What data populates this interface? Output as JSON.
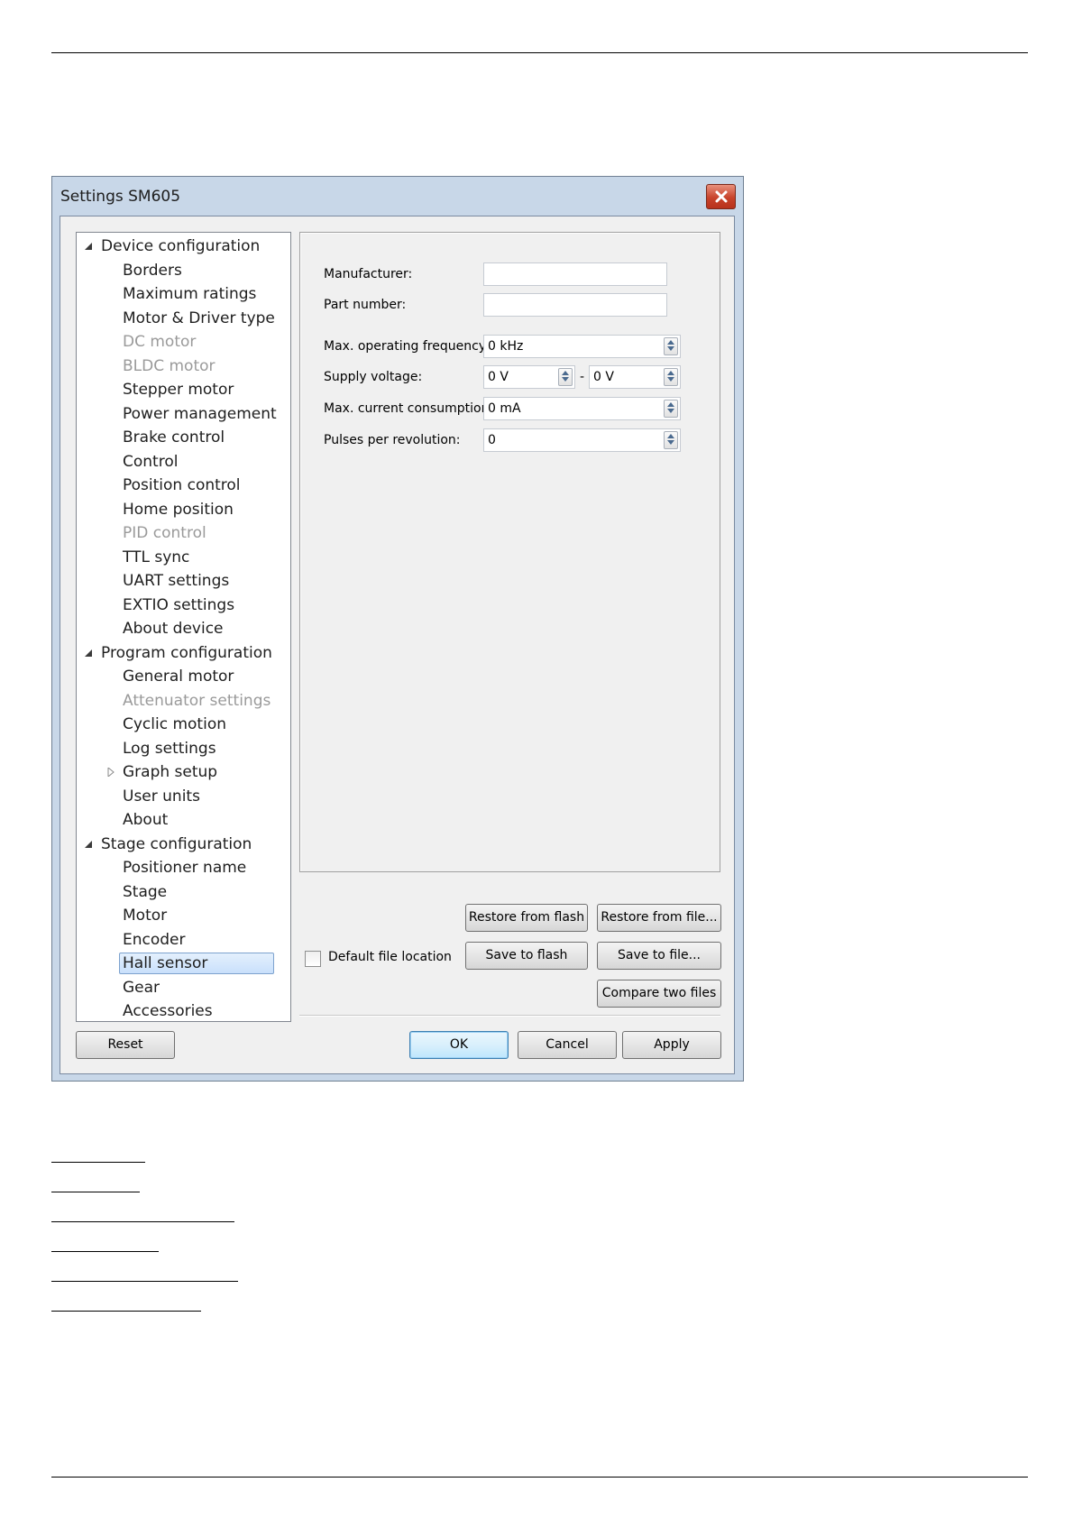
{
  "window": {
    "title": "Settings SM605"
  },
  "tree": {
    "items": [
      {
        "label": "Device configuration",
        "level": "root",
        "expanded": true
      },
      {
        "label": "Borders",
        "level": "child"
      },
      {
        "label": "Maximum ratings",
        "level": "child"
      },
      {
        "label": "Motor & Driver type",
        "level": "child"
      },
      {
        "label": "DC motor",
        "level": "child",
        "disabled": true
      },
      {
        "label": "BLDC motor",
        "level": "child",
        "disabled": true
      },
      {
        "label": "Stepper motor",
        "level": "child"
      },
      {
        "label": "Power management",
        "level": "child"
      },
      {
        "label": "Brake control",
        "level": "child"
      },
      {
        "label": "Control",
        "level": "child"
      },
      {
        "label": "Position control",
        "level": "child"
      },
      {
        "label": "Home position",
        "level": "child"
      },
      {
        "label": "PID control",
        "level": "child",
        "disabled": true
      },
      {
        "label": "TTL sync",
        "level": "child"
      },
      {
        "label": "UART settings",
        "level": "child"
      },
      {
        "label": "EXTIO settings",
        "level": "child"
      },
      {
        "label": "About device",
        "level": "child"
      },
      {
        "label": "Program configuration",
        "level": "root",
        "expanded": true
      },
      {
        "label": "General motor",
        "level": "child"
      },
      {
        "label": "Attenuator settings",
        "level": "child",
        "disabled": true
      },
      {
        "label": "Cyclic motion",
        "level": "child"
      },
      {
        "label": "Log settings",
        "level": "child"
      },
      {
        "label": "Graph setup",
        "level": "child",
        "collapsed": true
      },
      {
        "label": "User units",
        "level": "child"
      },
      {
        "label": "About",
        "level": "child"
      },
      {
        "label": "Stage configuration",
        "level": "root",
        "expanded": true
      },
      {
        "label": "Positioner name",
        "level": "child"
      },
      {
        "label": "Stage",
        "level": "child"
      },
      {
        "label": "Motor",
        "level": "child"
      },
      {
        "label": "Encoder",
        "level": "child"
      },
      {
        "label": "Hall sensor",
        "level": "child",
        "selected": true
      },
      {
        "label": "Gear",
        "level": "child"
      },
      {
        "label": "Accessories",
        "level": "child"
      }
    ]
  },
  "form": {
    "manufacturer_label": "Manufacturer:",
    "manufacturer_value": "",
    "part_number_label": "Part number:",
    "part_number_value": "",
    "max_freq_label": "Max. operating frequency:",
    "max_freq_value": "0 kHz",
    "supply_voltage_label": "Supply voltage:",
    "supply_voltage_min": "0 V",
    "supply_voltage_sep": "-",
    "supply_voltage_max": "0 V",
    "max_current_label": "Max. current consumption:",
    "max_current_value": "0 mA",
    "pulses_label": "Pulses per revolution:",
    "pulses_value": "0"
  },
  "file_actions": {
    "restore_flash": "Restore from flash",
    "restore_file": "Restore from file...",
    "default_location": "Default file location",
    "default_location_checked": false,
    "save_flash": "Save to flash",
    "save_file": "Save to file...",
    "compare": "Compare two files"
  },
  "footer": {
    "reset": "Reset",
    "ok": "OK",
    "cancel": "Cancel",
    "apply": "Apply"
  },
  "colors": {
    "selection": "#cce2fb",
    "disabled_text": "#9a9a9a",
    "close_button": "#c8432b"
  }
}
